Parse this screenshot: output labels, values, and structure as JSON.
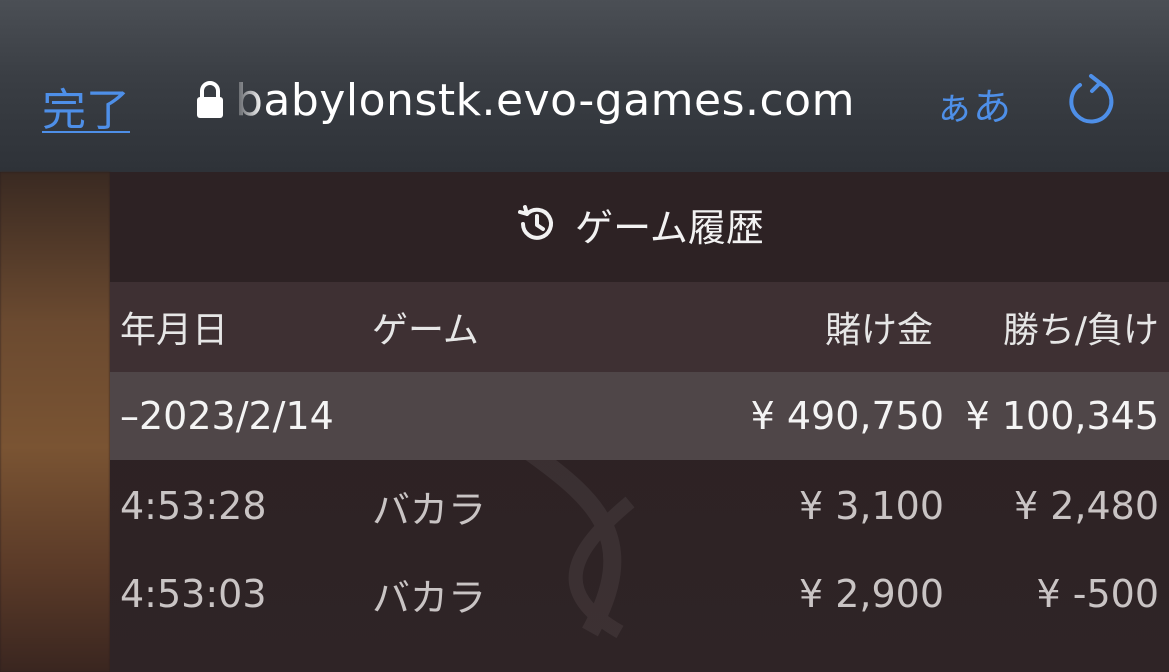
{
  "browser": {
    "done_label": "完了",
    "url": "babylonstk.evo-games.com",
    "text_size_label": "ぁあ",
    "icons": {
      "lock": "lock-icon",
      "reload": "reload-icon"
    },
    "accent_color": "#4e8fe8"
  },
  "panel": {
    "title": "ゲーム履歴",
    "title_icon": "history-icon"
  },
  "table": {
    "headers": {
      "date": "年月日",
      "game": "ゲーム",
      "bet": "賭け金",
      "win_loss": "勝ち/負け"
    },
    "summary": {
      "date": "–2023/2/14",
      "bet": "¥ 490,750",
      "win_loss": "¥ 100,345"
    },
    "rows": [
      {
        "time": "4:53:28",
        "game": "バカラ",
        "bet": "¥ 3,100",
        "win_loss": "¥ 2,480"
      },
      {
        "time": "4:53:03",
        "game": "バカラ",
        "bet": "¥ 2,900",
        "win_loss": "¥ -500"
      }
    ]
  }
}
